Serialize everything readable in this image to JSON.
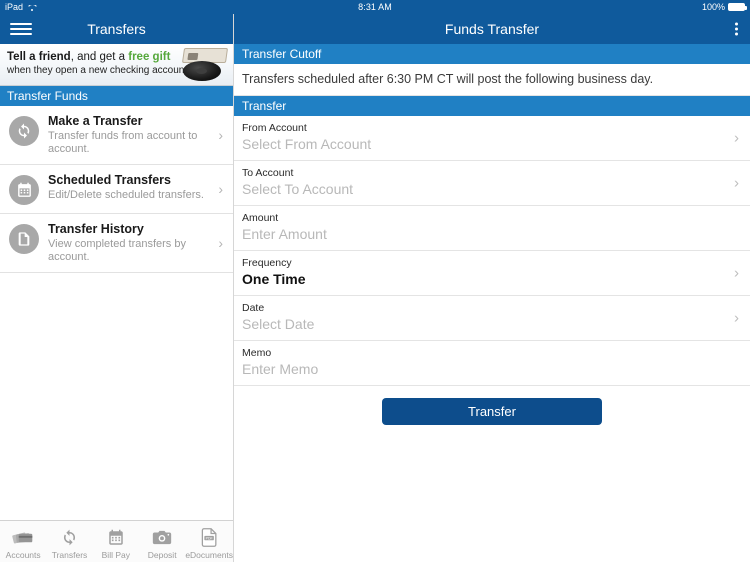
{
  "status_bar": {
    "device": "iPad",
    "wifi_icon": "wifi-icon",
    "time": "8:31 AM",
    "battery_percent": "100%",
    "battery_icon": "battery-full-icon"
  },
  "colors": {
    "navbar_blue": "#0f5a9c",
    "section_header_blue": "#2080c4",
    "button_navy": "#0d4d8c",
    "accent_green": "#56a83c",
    "icon_gray": "#a8a8a8",
    "placeholder_gray": "#b8b8b8"
  },
  "left_panel": {
    "menu_icon": "hamburger-menu-icon",
    "title": "Transfers",
    "promo": {
      "line1_bold": "Tell a friend",
      "line1_mid": ", and get a ",
      "line1_green": "free gift",
      "line2": "when they open a new checking account!",
      "image_name": "speaker-product-image"
    },
    "section_title": "Transfer Funds",
    "items": [
      {
        "icon": "sync-arrows-icon",
        "title": "Make a Transfer",
        "subtitle": "Transfer funds from account to account.",
        "chevron": "›"
      },
      {
        "icon": "calendar-icon",
        "title": "Scheduled Transfers",
        "subtitle": "Edit/Delete scheduled transfers.",
        "chevron": "›"
      },
      {
        "icon": "document-icon",
        "title": "Transfer History",
        "subtitle": "View completed transfers by account.",
        "chevron": "›"
      }
    ]
  },
  "tab_bar": {
    "items": [
      {
        "icon": "credit-cards-icon",
        "label": "Accounts"
      },
      {
        "icon": "sync-arrows-icon",
        "label": "Transfers"
      },
      {
        "icon": "calendar-icon",
        "label": "Bill Pay"
      },
      {
        "icon": "camera-icon",
        "label": "Deposit"
      },
      {
        "icon": "pdf-document-icon",
        "label": "eDocuments"
      }
    ]
  },
  "right_panel": {
    "title": "Funds Transfer",
    "overflow_icon": "vertical-dots-menu-icon",
    "cutoff_header": "Transfer Cutoff",
    "cutoff_notice": "Transfers scheduled after 6:30 PM CT will post the following business day.",
    "transfer_header": "Transfer",
    "fields": [
      {
        "label": "From Account",
        "value": "Select From Account",
        "filled": false,
        "chevron": "›"
      },
      {
        "label": "To Account",
        "value": "Select To Account",
        "filled": false,
        "chevron": "›"
      },
      {
        "label": "Amount",
        "value": "Enter Amount",
        "filled": false,
        "chevron": ""
      },
      {
        "label": "Frequency",
        "value": "One Time",
        "filled": true,
        "chevron": "›"
      },
      {
        "label": "Date",
        "value": "Select Date",
        "filled": false,
        "chevron": "›"
      },
      {
        "label": "Memo",
        "value": "Enter Memo",
        "filled": false,
        "chevron": ""
      }
    ],
    "submit_label": "Transfer"
  }
}
